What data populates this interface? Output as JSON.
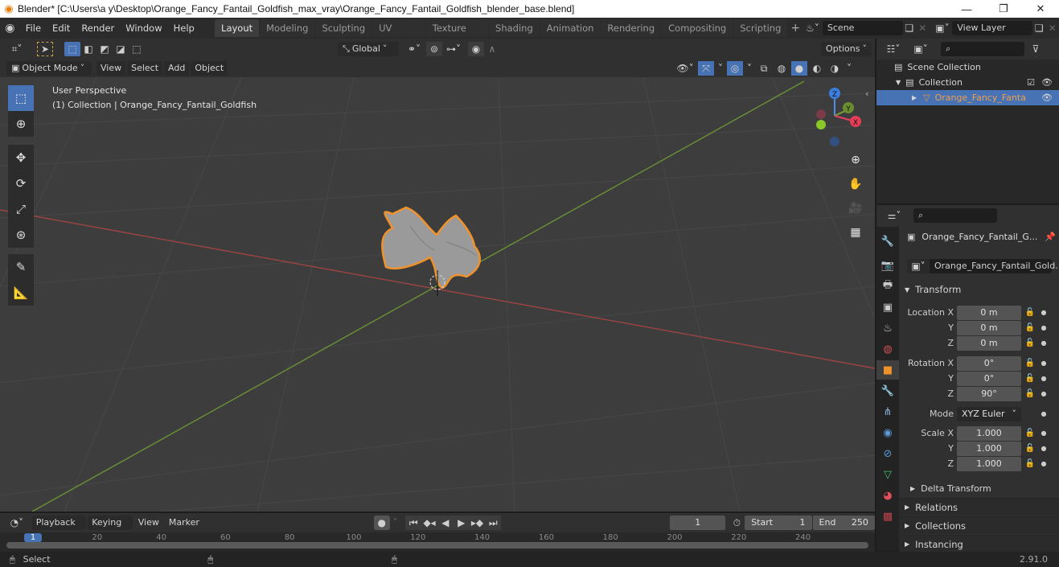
{
  "window": {
    "title": "Blender* [C:\\Users\\a y\\Desktop\\Orange_Fancy_Fantail_Goldfish_max_vray\\Orange_Fancy_Fantail_Goldfish_blender_base.blend]",
    "minimize": "—",
    "maximize": "❐",
    "close": "✕"
  },
  "menu": [
    "File",
    "Edit",
    "Render",
    "Window",
    "Help"
  ],
  "workspaces": {
    "active": "Layout",
    "tabs": [
      "Layout",
      "Modeling",
      "Sculpting",
      "UV Editing",
      "Texture Paint",
      "Shading",
      "Animation",
      "Rendering",
      "Compositing",
      "Scripting"
    ],
    "add": "+"
  },
  "scene": {
    "name": "Scene"
  },
  "view_layer": {
    "name": "View Layer"
  },
  "toolheader": {
    "orientation": "Global",
    "options": "Options"
  },
  "viewport_header": {
    "mode": "Object Mode",
    "menus": [
      "View",
      "Select",
      "Add",
      "Object"
    ]
  },
  "viewport": {
    "perspective": "User Perspective",
    "context": "(1) Collection | Orange_Fancy_Fantail_Goldfish",
    "axes": {
      "x": "X",
      "y": "Y",
      "z": "Z"
    },
    "colors": {
      "x_axis": "#b34a4a",
      "y_axis": "#6e9c3a",
      "selection": "#f0922b"
    }
  },
  "outliner": {
    "search_placeholder": "",
    "scene_collection": "Scene Collection",
    "collection": "Collection",
    "object": "Orange_Fancy_Fantail_Goldfish",
    "object_display": "Orange_Fancy_Fanta"
  },
  "properties": {
    "object_name": "Orange_Fancy_Fantail_G...",
    "object_field": "Orange_Fancy_Fantail_Gold...",
    "transform_title": "Transform",
    "location": {
      "label": "Location X",
      "x": "0 m",
      "y": "0 m",
      "z": "0 m"
    },
    "rotation": {
      "label": "Rotation X",
      "x": "0°",
      "y": "0°",
      "z": "90°"
    },
    "mode": {
      "label": "Mode",
      "value": "XYZ Euler"
    },
    "scale": {
      "label": "Scale X",
      "x": "1.000",
      "y": "1.000",
      "z": "1.000"
    },
    "axis_y": "Y",
    "axis_z": "Z",
    "sections": [
      "Delta Transform",
      "Relations",
      "Collections",
      "Instancing"
    ]
  },
  "timeline": {
    "menus": [
      "Playback",
      "Keying",
      "View",
      "Marker"
    ],
    "current_frame": "1",
    "start_label": "Start",
    "start": "1",
    "end_label": "End",
    "end": "250",
    "ruler": [
      "1",
      "20",
      "40",
      "60",
      "80",
      "100",
      "120",
      "140",
      "160",
      "180",
      "200",
      "220",
      "240"
    ]
  },
  "status": {
    "select": "Select",
    "version": "2.91.0"
  }
}
